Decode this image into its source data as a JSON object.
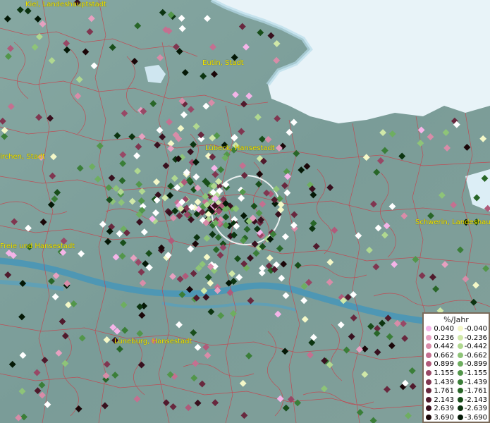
{
  "map": {
    "cities": [
      {
        "name": "Kiel, Landeshauptstadt"
      },
      {
        "name": "Eutin, Stadt"
      },
      {
        "name": "Lübeck, Hansestadt"
      },
      {
        "name": "Elmshorn, Stadt",
        "shown": "irchen, Stadt"
      },
      {
        "name": "Freie und Hansestadt",
        "shown": "Freie und Hansestadt"
      },
      {
        "name": "Schwerin, Landeshauptstadt",
        "shown": "Schwerin, Landeshaup"
      },
      {
        "name": "Lüneburg, Hansestadt"
      }
    ]
  },
  "legend": {
    "title": "%/Jahr",
    "positive": [
      {
        "value": "0.040",
        "color": "#f4b4e8"
      },
      {
        "value": "0.236",
        "color": "#e7a0c0"
      },
      {
        "value": "0.442",
        "color": "#d88ca8"
      },
      {
        "value": "0.662",
        "color": "#c47090"
      },
      {
        "value": "0.899",
        "color": "#b05a7a"
      },
      {
        "value": "1.155",
        "color": "#984866"
      },
      {
        "value": "1.439",
        "color": "#803650"
      },
      {
        "value": "1.761",
        "color": "#68283e"
      },
      {
        "value": "2.143",
        "color": "#501a2c"
      },
      {
        "value": "2.639",
        "color": "#38101e"
      },
      {
        "value": "3.690",
        "color": "#1a0608"
      }
    ],
    "negative": [
      {
        "value": "-0.040",
        "color": "#f4f8c8"
      },
      {
        "value": "-0.236",
        "color": "#d0e8a8"
      },
      {
        "value": "-0.442",
        "color": "#b0d890"
      },
      {
        "value": "-0.662",
        "color": "#8ec478"
      },
      {
        "value": "-0.899",
        "color": "#6eae60"
      },
      {
        "value": "-1.155",
        "color": "#52964a"
      },
      {
        "value": "-1.439",
        "color": "#3a7e38"
      },
      {
        "value": "-1.761",
        "color": "#286628"
      },
      {
        "value": "-2.143",
        "color": "#184e1a"
      },
      {
        "value": "-2.639",
        "color": "#0c3410"
      },
      {
        "value": "-3.690",
        "color": "#041806"
      }
    ]
  }
}
